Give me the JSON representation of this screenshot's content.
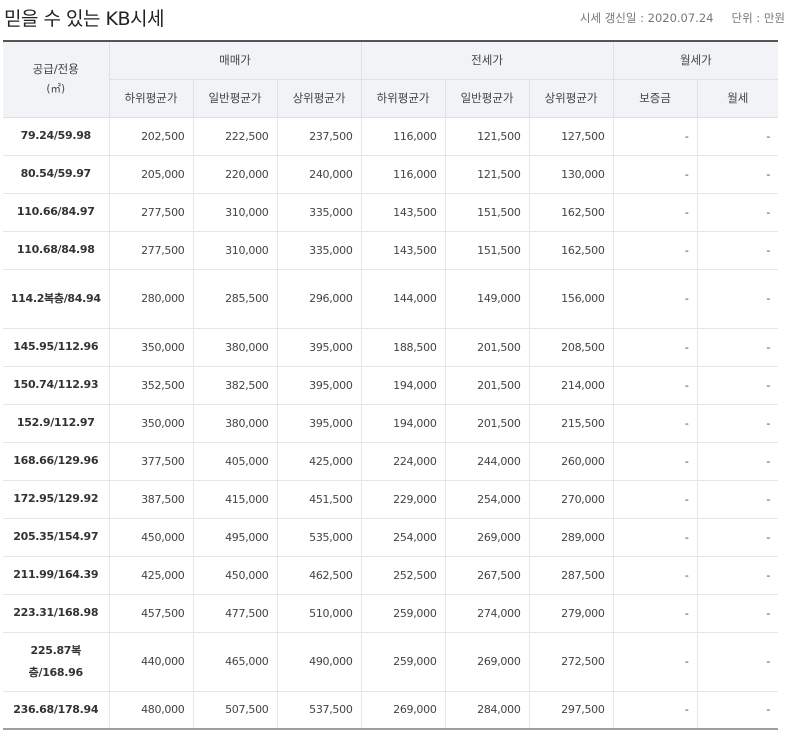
{
  "title": "믿을 수 있는 KB시세",
  "update_label": "시세 갱신일 : 2020.07.24",
  "unit_label": "단위 : 만원",
  "header": {
    "area": "공급/전용",
    "area_unit": "(㎡)",
    "sale": "매매가",
    "jeonse": "전세가",
    "monthly": "월세가",
    "low": "하위평균가",
    "mid": "일반평균가",
    "high": "상위평균가",
    "deposit": "보증금",
    "rent": "월세"
  },
  "rows": [
    {
      "area": "79.24/59.98",
      "s_low": "202,500",
      "s_mid": "222,500",
      "s_high": "237,500",
      "j_low": "116,000",
      "j_mid": "121,500",
      "j_high": "127,500",
      "deposit": "-",
      "rent": "-"
    },
    {
      "area": "80.54/59.97",
      "s_low": "205,000",
      "s_mid": "220,000",
      "s_high": "240,000",
      "j_low": "116,000",
      "j_mid": "121,500",
      "j_high": "130,000",
      "deposit": "-",
      "rent": "-"
    },
    {
      "area": "110.66/84.97",
      "s_low": "277,500",
      "s_mid": "310,000",
      "s_high": "335,000",
      "j_low": "143,500",
      "j_mid": "151,500",
      "j_high": "162,500",
      "deposit": "-",
      "rent": "-"
    },
    {
      "area": "110.68/84.98",
      "s_low": "277,500",
      "s_mid": "310,000",
      "s_high": "335,000",
      "j_low": "143,500",
      "j_mid": "151,500",
      "j_high": "162,500",
      "deposit": "-",
      "rent": "-"
    },
    {
      "area": "114.2복층/84.94",
      "s_low": "280,000",
      "s_mid": "285,500",
      "s_high": "296,000",
      "j_low": "144,000",
      "j_mid": "149,000",
      "j_high": "156,000",
      "deposit": "-",
      "rent": "-"
    },
    {
      "area": "145.95/112.96",
      "s_low": "350,000",
      "s_mid": "380,000",
      "s_high": "395,000",
      "j_low": "188,500",
      "j_mid": "201,500",
      "j_high": "208,500",
      "deposit": "-",
      "rent": "-"
    },
    {
      "area": "150.74/112.93",
      "s_low": "352,500",
      "s_mid": "382,500",
      "s_high": "395,000",
      "j_low": "194,000",
      "j_mid": "201,500",
      "j_high": "214,000",
      "deposit": "-",
      "rent": "-"
    },
    {
      "area": "152.9/112.97",
      "s_low": "350,000",
      "s_mid": "380,000",
      "s_high": "395,000",
      "j_low": "194,000",
      "j_mid": "201,500",
      "j_high": "215,500",
      "deposit": "-",
      "rent": "-"
    },
    {
      "area": "168.66/129.96",
      "s_low": "377,500",
      "s_mid": "405,000",
      "s_high": "425,000",
      "j_low": "224,000",
      "j_mid": "244,000",
      "j_high": "260,000",
      "deposit": "-",
      "rent": "-"
    },
    {
      "area": "172.95/129.92",
      "s_low": "387,500",
      "s_mid": "415,000",
      "s_high": "451,500",
      "j_low": "229,000",
      "j_mid": "254,000",
      "j_high": "270,000",
      "deposit": "-",
      "rent": "-"
    },
    {
      "area": "205.35/154.97",
      "s_low": "450,000",
      "s_mid": "495,000",
      "s_high": "535,000",
      "j_low": "254,000",
      "j_mid": "269,000",
      "j_high": "289,000",
      "deposit": "-",
      "rent": "-"
    },
    {
      "area": "211.99/164.39",
      "s_low": "425,000",
      "s_mid": "450,000",
      "s_high": "462,500",
      "j_low": "252,500",
      "j_mid": "267,500",
      "j_high": "287,500",
      "deposit": "-",
      "rent": "-"
    },
    {
      "area": "223.31/168.98",
      "s_low": "457,500",
      "s_mid": "477,500",
      "s_high": "510,000",
      "j_low": "259,000",
      "j_mid": "274,000",
      "j_high": "279,000",
      "deposit": "-",
      "rent": "-"
    },
    {
      "area": "225.87복층/168.96",
      "s_low": "440,000",
      "s_mid": "465,000",
      "s_high": "490,000",
      "j_low": "259,000",
      "j_mid": "269,000",
      "j_high": "272,500",
      "deposit": "-",
      "rent": "-"
    },
    {
      "area": "236.68/178.94",
      "s_low": "480,000",
      "s_mid": "507,500",
      "s_high": "537,500",
      "j_low": "269,000",
      "j_mid": "284,000",
      "j_high": "297,500",
      "deposit": "-",
      "rent": "-"
    }
  ]
}
